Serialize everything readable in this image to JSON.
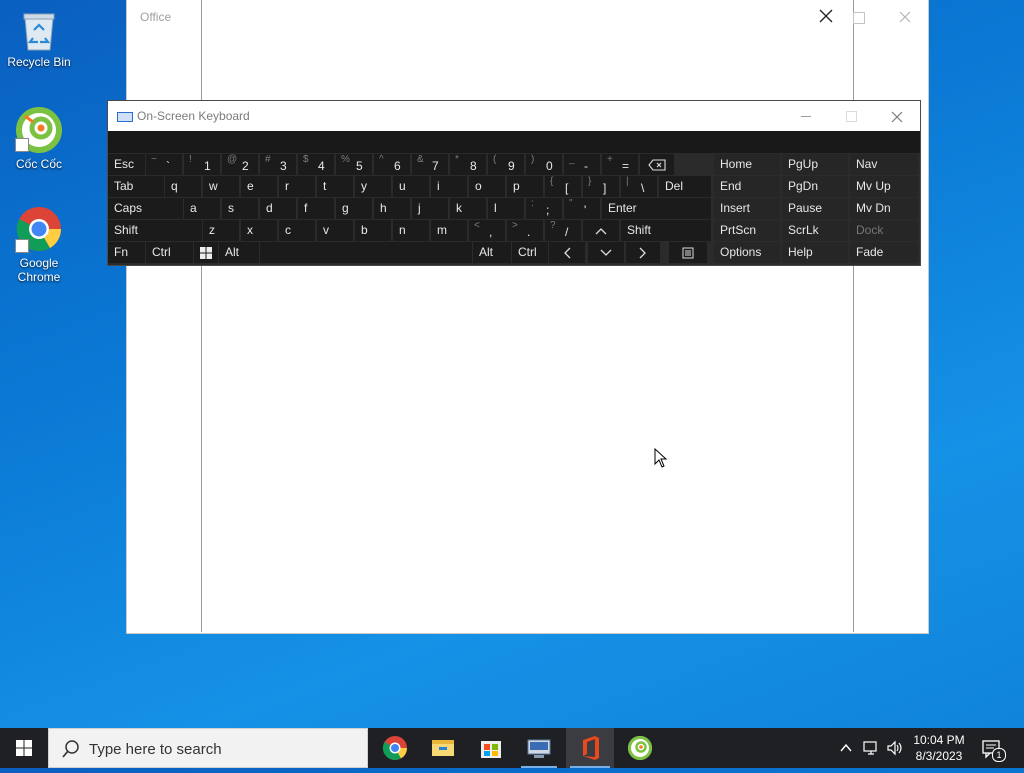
{
  "desktop": {
    "icons": [
      {
        "label": "Recycle Bin",
        "icon": "recycle-bin-icon"
      },
      {
        "label": "Cốc Cốc",
        "icon": "coccoc-icon"
      },
      {
        "label": "Google Chrome",
        "icon": "chrome-icon"
      }
    ]
  },
  "office_window": {
    "title": "Office"
  },
  "osk": {
    "title": "On-Screen Keyboard",
    "rows": {
      "r1": [
        {
          "label": "Esc"
        },
        {
          "sub": "~",
          "main": "`"
        },
        {
          "sub": "!",
          "main": "1"
        },
        {
          "sub": "@",
          "main": "2"
        },
        {
          "sub": "#",
          "main": "3"
        },
        {
          "sub": "$",
          "main": "4"
        },
        {
          "sub": "%",
          "main": "5"
        },
        {
          "sub": "^",
          "main": "6"
        },
        {
          "sub": "&",
          "main": "7"
        },
        {
          "sub": "*",
          "main": "8"
        },
        {
          "sub": "(",
          "main": "9"
        },
        {
          "sub": ")",
          "main": "0"
        },
        {
          "sub": "_",
          "main": "-"
        },
        {
          "sub": "+",
          "main": "="
        },
        {
          "icon": "backspace-icon"
        },
        {
          "label": "Home"
        },
        {
          "label": "PgUp"
        },
        {
          "label": "Nav"
        }
      ],
      "r2": [
        {
          "label": "Tab"
        },
        {
          "label": "q"
        },
        {
          "label": "w"
        },
        {
          "label": "e"
        },
        {
          "label": "r"
        },
        {
          "label": "t"
        },
        {
          "label": "y"
        },
        {
          "label": "u"
        },
        {
          "label": "i"
        },
        {
          "label": "o"
        },
        {
          "label": "p"
        },
        {
          "sub": "{",
          "main": "["
        },
        {
          "sub": "}",
          "main": "]"
        },
        {
          "sub": "|",
          "main": "\\"
        },
        {
          "label": "Del"
        },
        {
          "label": "End"
        },
        {
          "label": "PgDn"
        },
        {
          "label": "Mv Up"
        }
      ],
      "r3": [
        {
          "label": "Caps"
        },
        {
          "label": "a"
        },
        {
          "label": "s"
        },
        {
          "label": "d"
        },
        {
          "label": "f"
        },
        {
          "label": "g"
        },
        {
          "label": "h"
        },
        {
          "label": "j"
        },
        {
          "label": "k"
        },
        {
          "label": "l"
        },
        {
          "sub": ":",
          "main": ";"
        },
        {
          "sub": "\"",
          "main": "'"
        },
        {
          "label": "Enter"
        },
        {
          "label": "Insert"
        },
        {
          "label": "Pause"
        },
        {
          "label": "Mv Dn"
        }
      ],
      "r4": [
        {
          "label": "Shift"
        },
        {
          "label": "z"
        },
        {
          "label": "x"
        },
        {
          "label": "c"
        },
        {
          "label": "v"
        },
        {
          "label": "b"
        },
        {
          "label": "n"
        },
        {
          "label": "m"
        },
        {
          "sub": "<",
          "main": ","
        },
        {
          "sub": ">",
          "main": "."
        },
        {
          "sub": "?",
          "main": "/"
        },
        {
          "icon": "arrow-up-icon"
        },
        {
          "label": "Shift"
        },
        {
          "label": "PrtScn"
        },
        {
          "label": "ScrLk"
        },
        {
          "label": "Dock"
        }
      ],
      "r5": [
        {
          "label": "Fn"
        },
        {
          "label": "Ctrl"
        },
        {
          "icon": "windows-key-icon"
        },
        {
          "label": "Alt"
        },
        {
          "label": ""
        },
        {
          "label": "Alt"
        },
        {
          "label": "Ctrl"
        },
        {
          "icon": "arrow-left-icon"
        },
        {
          "icon": "arrow-down-icon"
        },
        {
          "icon": "arrow-right-icon"
        },
        {
          "icon": "menu-key-icon"
        },
        {
          "label": "Options"
        },
        {
          "label": "Help"
        },
        {
          "label": "Fade"
        }
      ]
    }
  },
  "taskbar": {
    "search_placeholder": "Type here to search",
    "apps": [
      "chrome-icon",
      "file-explorer-icon",
      "store-icon",
      "network-app-icon",
      "office-icon",
      "coccoc-icon"
    ],
    "clock": {
      "time": "10:04 PM",
      "date": "8/3/2023"
    },
    "notification_count": "1"
  },
  "colors": {
    "desktop": "#0a78d4",
    "osk_key": "#1b1b1b",
    "taskbar": "#1f2024"
  }
}
